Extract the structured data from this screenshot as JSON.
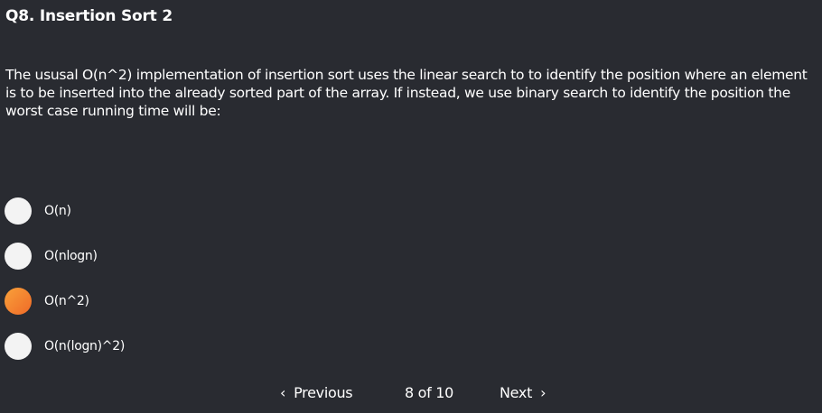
{
  "question": {
    "title": "Q8. Insertion Sort 2",
    "text": "The ususal O(n^2) implementation of insertion sort uses the linear search to to identify the position where an element is to be inserted into the already sorted part of the array. If instead, we use binary search to identify the position the worst case running time will be:"
  },
  "options": [
    {
      "label": "O(n)",
      "selected": false
    },
    {
      "label": "O(nlogn)",
      "selected": false
    },
    {
      "label": "O(n^2)",
      "selected": true
    },
    {
      "label": "O(n(logn)^2)",
      "selected": false
    }
  ],
  "nav": {
    "prev_icon": "‹",
    "prev_label": "Previous",
    "counter": "8 of 10",
    "next_label": "Next",
    "next_icon": "›"
  },
  "colors": {
    "background": "#292b31",
    "text": "#ffffff",
    "radio_unselected": "#f3f3f3",
    "radio_selected_start": "#f9a13a",
    "radio_selected_end": "#ef6a28"
  }
}
